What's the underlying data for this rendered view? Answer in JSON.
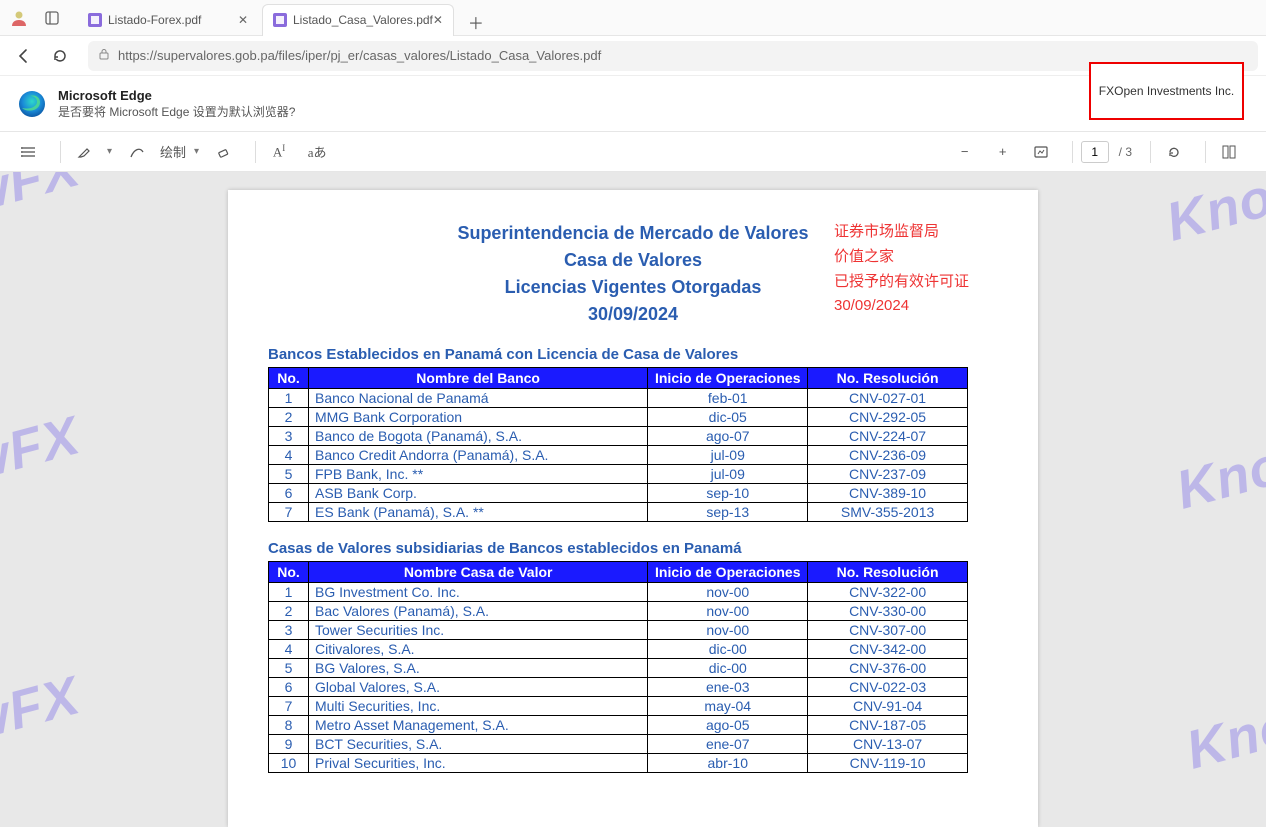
{
  "window": {
    "tabs": [
      {
        "title": "Listado-Forex.pdf",
        "active": false
      },
      {
        "title": "Listado_Casa_Valores.pdf",
        "active": true
      }
    ],
    "url": "https://supervalores.gob.pa/files/iper/pj_er/casas_valores/Listado_Casa_Valores.pdf"
  },
  "banner": {
    "title": "Microsoft Edge",
    "subtitle": "是否要将 Microsoft Edge 设置为默认浏览器?"
  },
  "pdf_toolbar": {
    "draw_label": "绘制",
    "page_current": "1",
    "page_total": "/ 3"
  },
  "highlight": {
    "text": "FXOpen Investments Inc."
  },
  "watermark": "KnowFX",
  "document": {
    "title_lines": [
      "Superintendencia de Mercado de Valores",
      "Casa de Valores",
      "Licencias  Vigentes Otorgadas",
      "30/09/2024"
    ],
    "annotation_cn": [
      "证券市场监督局",
      "价值之家",
      "已授予的有效许可证",
      "30/09/2024"
    ],
    "section1_title": "Bancos Establecidos en Panamá con Licencia de Casa de Valores",
    "section2_title": "Casas de Valores  subsidiarias  de Bancos establecidos en Panamá",
    "headers1": {
      "no": "No.",
      "name": "Nombre del Banco",
      "op": "Inicio de Operaciones",
      "res": "No. Resolución"
    },
    "headers2": {
      "no": "No.",
      "name": "Nombre Casa de Valor",
      "op": "Inicio de Operaciones",
      "res": "No. Resolución"
    },
    "table1": [
      {
        "no": "1",
        "name": "Banco Nacional de Panamá",
        "op": "feb-01",
        "res": "CNV-027-01"
      },
      {
        "no": "2",
        "name": "MMG Bank Corporation",
        "op": "dic-05",
        "res": "CNV-292-05"
      },
      {
        "no": "3",
        "name": "Banco de Bogota (Panamá), S.A.",
        "op": "ago-07",
        "res": "CNV-224-07"
      },
      {
        "no": "4",
        "name": "Banco Credit Andorra (Panamá), S.A.",
        "op": "jul-09",
        "res": "CNV-236-09"
      },
      {
        "no": "5",
        "name": "FPB Bank, Inc. **",
        "op": "jul-09",
        "res": "CNV-237-09"
      },
      {
        "no": "6",
        "name": "ASB Bank Corp.",
        "op": "sep-10",
        "res": "CNV-389-10"
      },
      {
        "no": "7",
        "name": "ES Bank (Panamá), S.A. **",
        "op": "sep-13",
        "res": "SMV-355-2013"
      }
    ],
    "table2": [
      {
        "no": "1",
        "name": "BG Investment Co. Inc.",
        "op": "nov-00",
        "res": "CNV-322-00"
      },
      {
        "no": "2",
        "name": "Bac Valores (Panamá), S.A.",
        "op": "nov-00",
        "res": "CNV-330-00"
      },
      {
        "no": "3",
        "name": "Tower Securities Inc.",
        "op": "nov-00",
        "res": "CNV-307-00"
      },
      {
        "no": "4",
        "name": "Citivalores, S.A.",
        "op": "dic-00",
        "res": "CNV-342-00"
      },
      {
        "no": "5",
        "name": "BG Valores, S.A.",
        "op": "dic-00",
        "res": "CNV-376-00"
      },
      {
        "no": "6",
        "name": "Global Valores, S.A.",
        "op": "ene-03",
        "res": "CNV-022-03"
      },
      {
        "no": "7",
        "name": "Multi Securities, Inc.",
        "op": "may-04",
        "res": "CNV-91-04"
      },
      {
        "no": "8",
        "name": "Metro Asset Management, S.A.",
        "op": "ago-05",
        "res": "CNV-187-05"
      },
      {
        "no": "9",
        "name": "BCT Securities, S.A.",
        "op": "ene-07",
        "res": "CNV-13-07"
      },
      {
        "no": "10",
        "name": "Prival Securities, Inc.",
        "op": "abr-10",
        "res": "CNV-119-10"
      }
    ]
  }
}
